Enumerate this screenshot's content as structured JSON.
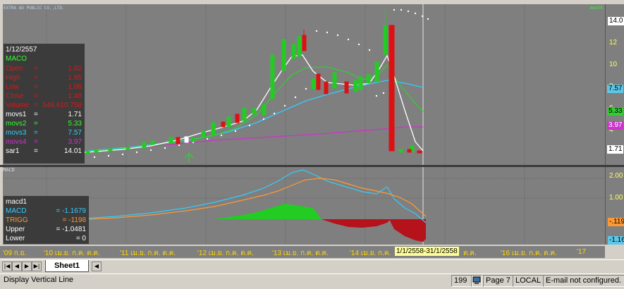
{
  "top_strip": {
    "title": "EXTRA AO PUBLIC CO.,LTD.",
    "right_tag": "month"
  },
  "info": {
    "date": "1/12/2557",
    "symbol": "MACO",
    "rows": [
      {
        "k": "Open",
        "v": "1.62",
        "color": "#d21b1b"
      },
      {
        "k": "High",
        "v": "1.65",
        "color": "#d21b1b"
      },
      {
        "k": "Low",
        "v": "1.08",
        "color": "#d21b1b"
      },
      {
        "k": "Close",
        "v": "1.48",
        "color": "#d21b1b"
      },
      {
        "k": "Volume",
        "v": "546,610,758",
        "color": "#d21b1b"
      },
      {
        "k": "movs1",
        "v": "1.71",
        "color": "#ffffff"
      },
      {
        "k": "movs2",
        "v": "5.33",
        "color": "#33ff33"
      },
      {
        "k": "movs3",
        "v": "7.57",
        "color": "#33ccff"
      },
      {
        "k": "movs4",
        "v": "3.97",
        "color": "#cc33cc"
      },
      {
        "k": "sar1",
        "v": "14.01",
        "color": "#ffffff"
      }
    ]
  },
  "price_axis": {
    "ticks": [
      "14.0",
      "12",
      "10",
      "8",
      "6",
      "4",
      "2"
    ],
    "badges": [
      {
        "text": "7.57",
        "bg": "#5ec6e8",
        "fg": "#000000"
      },
      {
        "text": "5.33",
        "bg": "#33cc33",
        "fg": "#000000"
      },
      {
        "text": "3.97",
        "bg": "#cc33cc",
        "fg": "#ffffff"
      },
      {
        "text": "1.71",
        "bg": "#ffffff",
        "fg": "#000000"
      }
    ]
  },
  "macd": {
    "title": "macd1",
    "rows": [
      {
        "k": "MACD",
        "v": "= -1.1679",
        "color": "#33ccff"
      },
      {
        "k": "TRIGG",
        "v": "= -1198",
        "color": "#ff9933"
      },
      {
        "k": "Upper",
        "v": "= -1.0481",
        "color": "#ffffff"
      },
      {
        "k": "Lower",
        "v": "= 0",
        "color": "#ffffff"
      }
    ]
  },
  "macd_axis": {
    "ticks": [
      "2.00",
      "1.00",
      "-.119",
      "-1.16"
    ]
  },
  "date_axis": {
    "labels": [
      "'09 ก.ย.",
      "'10 เม.ย. ก.ค. ต.ค.",
      "'11 เม.ย. ก.ค. ต.ค.",
      "'12 เม.ย. ก.ค. ต.ค.",
      "'13 เม.ย. ก.ค. ต.ค.",
      "'14 เม.ย. ก.ค.",
      "ต.ค.",
      "'16 เม.ย. ก.ค. ต.ค.",
      "'17"
    ],
    "highlight": "1/1/2558-31/1/2558"
  },
  "sheet_tab": {
    "label": "Sheet1"
  },
  "status": {
    "left": "Display Vertical Line",
    "count": "199",
    "page": "Page 7",
    "mode": "LOCAL",
    "email": "E-mail not configured."
  },
  "chart_data": {
    "type": "candlestick",
    "series": [
      {
        "name": "movs1",
        "values": [
          0.5,
          0.6,
          0.8,
          1.0,
          1.3,
          1.7,
          2.3,
          3.2,
          4.5,
          6.5,
          8.5,
          10.5,
          10.0,
          8.5,
          8.0,
          9.0,
          7.0,
          3.5,
          1.71
        ]
      },
      {
        "name": "movs2",
        "values": [
          0.5,
          0.6,
          0.7,
          0.9,
          1.1,
          1.4,
          1.9,
          2.6,
          3.5,
          5.0,
          6.5,
          8.2,
          8.8,
          8.4,
          8.0,
          8.1,
          7.5,
          6.2,
          5.33
        ]
      },
      {
        "name": "movs3",
        "values": [
          0.4,
          0.5,
          0.6,
          0.7,
          0.9,
          1.1,
          1.5,
          2.0,
          2.7,
          3.7,
          4.7,
          5.7,
          6.6,
          7.1,
          7.3,
          7.6,
          7.9,
          7.8,
          7.57
        ]
      },
      {
        "name": "movs4",
        "values": [
          0.3,
          0.3,
          0.4,
          0.5,
          0.6,
          0.8,
          1.0,
          1.3,
          1.6,
          2.0,
          2.4,
          2.8,
          3.1,
          3.4,
          3.6,
          3.8,
          3.9,
          4.0,
          3.97
        ]
      }
    ]
  }
}
